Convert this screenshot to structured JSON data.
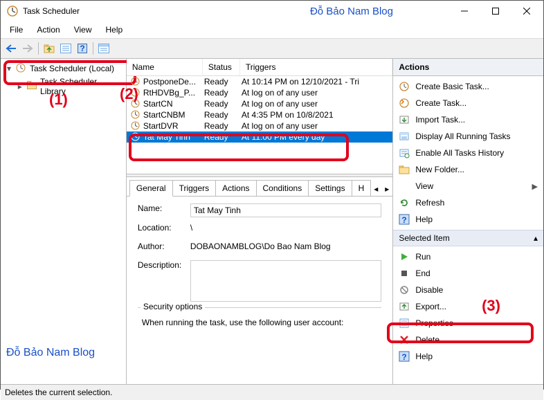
{
  "title_bar": {
    "app_title": "Task Scheduler",
    "brand": "Đỗ Bảo Nam Blog"
  },
  "menu": {
    "file": "File",
    "action": "Action",
    "view": "View",
    "help": "Help"
  },
  "tree": {
    "root": "Task Scheduler (Local)",
    "lib": "Task Scheduler Library"
  },
  "callouts": {
    "n1": "(1)",
    "n2": "(2)",
    "n3": "(3)"
  },
  "task_columns": {
    "name": "Name",
    "status": "Status",
    "triggers": "Triggers"
  },
  "tasks": [
    {
      "name": "PostponeDe...",
      "status": "Ready",
      "trigger": "At 10:14 PM on 12/10/2021 - Tri"
    },
    {
      "name": "RtHDVBg_P...",
      "status": "Ready",
      "trigger": "At log on of any user"
    },
    {
      "name": "StartCN",
      "status": "Ready",
      "trigger": "At log on of any user"
    },
    {
      "name": "StartCNBM",
      "status": "Ready",
      "trigger": "At 4:35 PM on 10/8/2021"
    },
    {
      "name": "StartDVR",
      "status": "Ready",
      "trigger": "At log on of any user"
    },
    {
      "name": "Tat May Tinh",
      "status": "Ready",
      "trigger": "At 11:00 PM every day"
    }
  ],
  "selected_task_index": 5,
  "tabs": {
    "general": "General",
    "triggers": "Triggers",
    "actions": "Actions",
    "conditions": "Conditions",
    "settings": "Settings",
    "history": "H"
  },
  "details": {
    "name_label": "Name:",
    "name_value": "Tat May Tinh",
    "location_label": "Location:",
    "location_value": "\\",
    "author_label": "Author:",
    "author_value": "DOBAONAMBLOG\\Do Bao Nam Blog",
    "description_label": "Description:",
    "description_value": "",
    "security_group": "Security options",
    "security_text": "When running the task, use the following user account:"
  },
  "actions": {
    "header": "Actions",
    "items1": [
      {
        "label": "Create Basic Task...",
        "icon": "create-basic"
      },
      {
        "label": "Create Task...",
        "icon": "create-task"
      },
      {
        "label": "Import Task...",
        "icon": "import"
      },
      {
        "label": "Display All Running Tasks",
        "icon": "running"
      },
      {
        "label": "Enable All Tasks History",
        "icon": "history"
      },
      {
        "label": "New Folder...",
        "icon": "folder"
      },
      {
        "label": "View",
        "icon": "view",
        "has_sub": true
      },
      {
        "label": "Refresh",
        "icon": "refresh"
      },
      {
        "label": "Help",
        "icon": "help"
      }
    ],
    "sel_header": "Selected Item",
    "items2": [
      {
        "label": "Run",
        "icon": "run"
      },
      {
        "label": "End",
        "icon": "end"
      },
      {
        "label": "Disable",
        "icon": "disable"
      },
      {
        "label": "Export...",
        "icon": "export"
      },
      {
        "label": "Properties",
        "icon": "properties"
      },
      {
        "label": "Delete",
        "icon": "delete"
      },
      {
        "label": "Help",
        "icon": "help"
      }
    ]
  },
  "status_bar": "Deletes the current selection.",
  "watermark": "Đỗ Bảo Nam Blog"
}
